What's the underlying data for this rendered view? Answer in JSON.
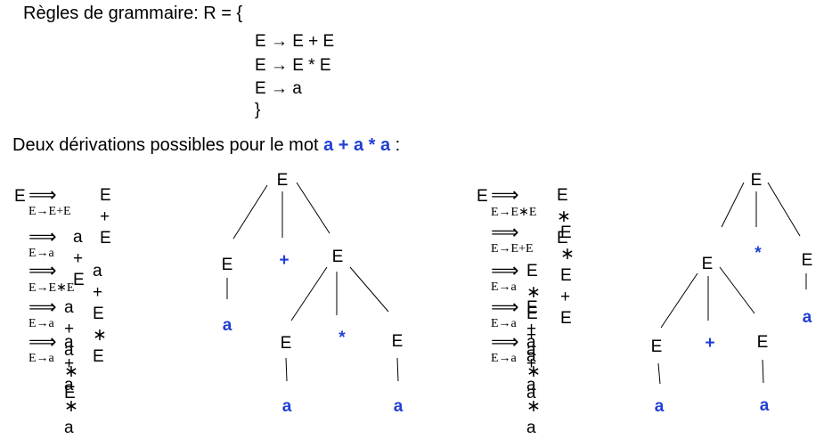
{
  "grammar": {
    "title": "Règles de grammaire: R = {",
    "rules": [
      "E → E + E",
      "E → E * E",
      "E → a"
    ],
    "close": "}"
  },
  "intro": {
    "text": "Deux dérivations possibles pour le mot ",
    "word": "a + a * a",
    "colon": " :"
  },
  "derivation_left": {
    "start": "E",
    "steps": [
      {
        "label": "E→E+E",
        "result": "E + E"
      },
      {
        "label": "E→a",
        "result": "a + E"
      },
      {
        "label": "E→E∗E",
        "result": "a + E ∗ E"
      },
      {
        "label": "E→a",
        "result": "a + a ∗ E"
      },
      {
        "label": "E→a",
        "result": "a + a ∗ a"
      }
    ]
  },
  "derivation_right": {
    "start": "E",
    "steps": [
      {
        "label": "E→E∗E",
        "result": "E ∗ E"
      },
      {
        "label": "E→E+E",
        "result": "E ∗ E + E"
      },
      {
        "label": "E→a",
        "result": "E ∗ E + a"
      },
      {
        "label": "E→a",
        "result": "E + a ∗ a"
      },
      {
        "label": "E→a",
        "result": "a + a ∗ a"
      }
    ]
  },
  "tree_left": {
    "nodes": {
      "root": "E",
      "left": "E",
      "plus": "+",
      "right": "E",
      "a1": "a",
      "rl": "E",
      "star": "*",
      "rr": "E",
      "a2": "a",
      "a3": "a"
    }
  },
  "tree_right": {
    "nodes": {
      "root": "E",
      "left": "E",
      "star": "*",
      "right": "E",
      "ll": "E",
      "plus": "+",
      "lr": "E",
      "a1": "a",
      "a2": "a",
      "a3": "a"
    }
  },
  "colors": {
    "accent": "#1f3fd6",
    "text": "#000000"
  }
}
